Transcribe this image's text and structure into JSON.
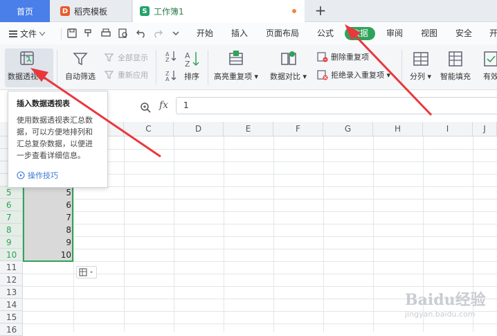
{
  "tabs": {
    "home": "首页",
    "template": "稻壳模板",
    "workbook": "工作簿1",
    "template_icon_char": "D",
    "workbook_icon_char": "S"
  },
  "menubar": {
    "file": "文件",
    "items": [
      "开始",
      "插入",
      "页面布局",
      "公式",
      "数据",
      "审阅",
      "视图",
      "安全",
      "开"
    ],
    "active_item": "数据"
  },
  "ribbon": {
    "pivot": "数据透视表",
    "auto_filter": "自动筛选",
    "show_all": "全部显示",
    "reapply": "重新应用",
    "sort": "排序",
    "highlight_dup": "高亮重复项",
    "data_compare": "数据对比",
    "remove_dup": "删除重复项",
    "reject_dup": "拒绝录入重复项",
    "split": "分列",
    "smart_fill": "智能填充",
    "valid": "有效"
  },
  "formula_bar": {
    "fx": "fx",
    "value": "1"
  },
  "grid": {
    "columns": [
      "C",
      "D",
      "E",
      "F",
      "G",
      "H",
      "I",
      "J"
    ],
    "rows": [
      "5",
      "6",
      "7",
      "8",
      "9",
      "10",
      "11",
      "12",
      "13",
      "14",
      "15",
      "16"
    ],
    "cell_values": [
      "5",
      "6",
      "7",
      "8",
      "9",
      "10"
    ]
  },
  "tooltip": {
    "title": "插入数据透视表",
    "body": "使用数据透视表汇总数据，可以方便地排列和汇总复杂数据，以便进一步查看详细信息。",
    "link": "操作技巧"
  },
  "watermark": {
    "brand": "Baidu经验",
    "url": "jingyan.baidu.com"
  },
  "colors": {
    "accent_green": "#2fa35a",
    "home_tab_blue": "#4a7ee8",
    "arrow_red": "#e8383d"
  }
}
